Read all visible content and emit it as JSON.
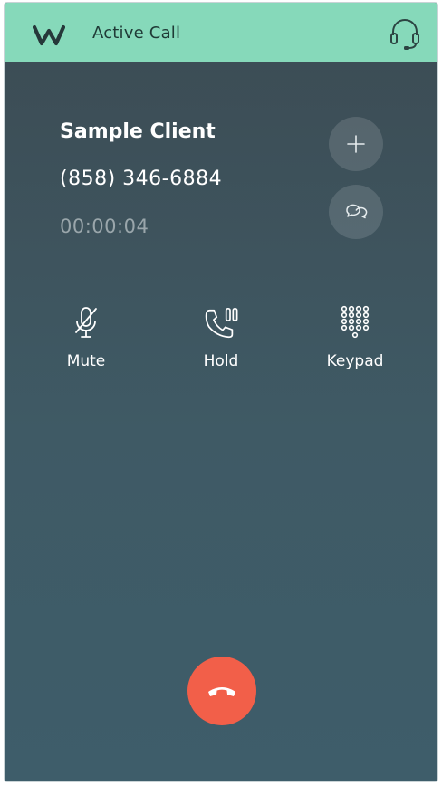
{
  "header": {
    "title": "Active Call",
    "logo_icon": "w-logo-icon",
    "support_icon": "headset-icon",
    "background": "#86d9ba"
  },
  "call": {
    "client_name": "Sample Client",
    "phone_number": "(858) 346-6884",
    "duration": "00:00:04"
  },
  "side_buttons": [
    {
      "icon": "plus-icon"
    },
    {
      "icon": "chat-bubbles-icon"
    }
  ],
  "actions": {
    "mute": {
      "label": "Mute",
      "icon": "microphone-muted-icon"
    },
    "hold": {
      "label": "Hold",
      "icon": "phone-pause-icon"
    },
    "keypad": {
      "label": "Keypad",
      "icon": "keypad-icon"
    }
  },
  "end_call": {
    "icon": "phone-hangup-icon",
    "color": "#f25f49"
  },
  "colors": {
    "background_top": "#3c4b53",
    "background_bottom": "#3e5d6a",
    "accent": "#86d9ba",
    "text": "#ffffff",
    "muted_text": "#9aa6ab"
  }
}
